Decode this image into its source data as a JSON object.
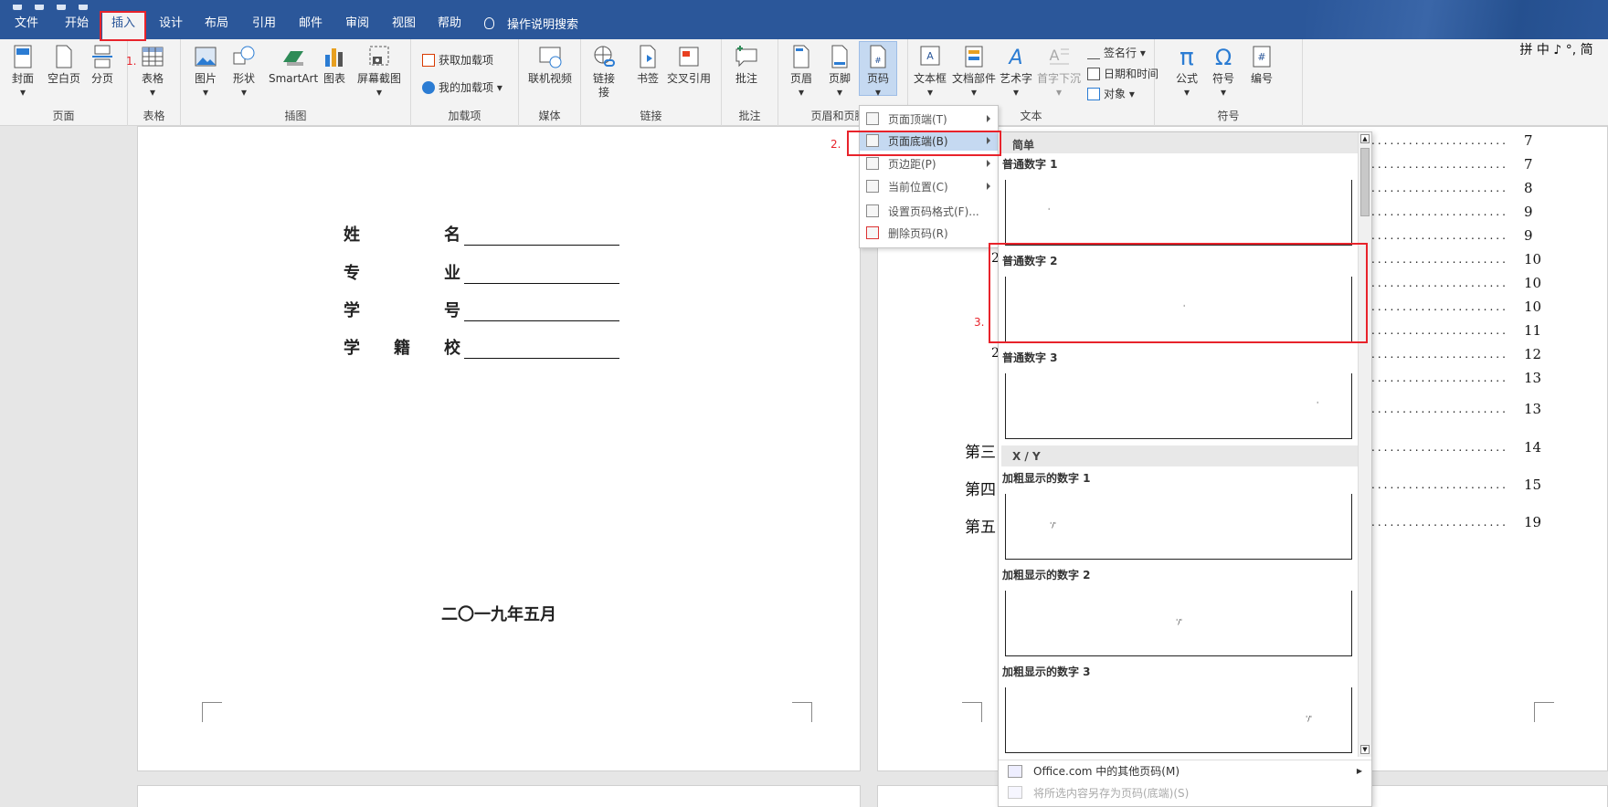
{
  "tabs": [
    "文件",
    "开始",
    "插入",
    "设计",
    "布局",
    "引用",
    "邮件",
    "审阅",
    "视图",
    "帮助"
  ],
  "tell_me": "操作说明搜索",
  "ribbon": {
    "pages": {
      "label": "页面",
      "buttons": [
        "封面",
        "空白页",
        "分页"
      ]
    },
    "table": {
      "label": "表格",
      "buttons": [
        "表格"
      ]
    },
    "illustrations": {
      "label": "插图",
      "buttons": [
        "图片",
        "形状",
        "SmartArt",
        "图表",
        "屏幕截图"
      ]
    },
    "addins": {
      "label": "加载项",
      "buttons": [
        "获取加载项",
        "我的加载项"
      ]
    },
    "media": {
      "label": "媒体",
      "buttons": [
        "联机视频"
      ]
    },
    "links": {
      "label": "链接",
      "buttons": [
        "链接",
        "书签",
        "交叉引用"
      ]
    },
    "comments": {
      "label": "批注",
      "buttons": [
        "批注"
      ]
    },
    "header_footer": {
      "label": "页眉和页脚",
      "buttons": [
        "页眉",
        "页脚",
        "页码"
      ]
    },
    "text": {
      "label": "文本",
      "buttons": [
        "文本框",
        "文档部件",
        "艺术字",
        "首字下沉"
      ],
      "small": [
        "签名行",
        "日期和时间",
        "对象"
      ]
    },
    "symbols": {
      "label": "符号",
      "buttons": [
        "公式",
        "符号",
        "编号"
      ]
    },
    "ime": "拼 中 ♪ °, 简"
  },
  "link_sub": "接",
  "doc_left": {
    "fields": [
      {
        "a": "姓",
        "b": "名"
      },
      {
        "a": "专",
        "b": "业"
      },
      {
        "a": "学",
        "b": "号"
      },
      {
        "a": "学",
        "m": "籍",
        "b": "校"
      }
    ],
    "date": "二〇一九年五月"
  },
  "doc_right": {
    "pages": [
      "7",
      "7",
      "8",
      "9",
      "9",
      "10",
      "10",
      "10",
      "11",
      "12",
      "13",
      "13",
      "14",
      "15",
      "19"
    ],
    "chapters": [
      "第三",
      "第四",
      "第五"
    ],
    "partial": [
      "2",
      "2"
    ],
    "dots": "......................"
  },
  "menu": {
    "items": [
      "页面顶端(T)",
      "页面底端(B)",
      "页边距(P)",
      "当前位置(C)",
      "设置页码格式(F)...",
      "删除页码(R)"
    ]
  },
  "gallery": {
    "section1": "简单",
    "items": [
      "普通数字 1",
      "普通数字 2",
      "普通数字 3"
    ],
    "section2": "X / Y",
    "items2": [
      "加粗显示的数字 1",
      "加粗显示的数字 2",
      "加粗显示的数字 3"
    ],
    "footer1": "Office.com 中的其他页码(M)",
    "footer2": "将所选内容另存为页码(底端)(S)"
  },
  "steps": [
    "1.",
    "2.",
    "3."
  ],
  "colors": {
    "accent": "#2b579a",
    "highlight": "#e8232b"
  }
}
